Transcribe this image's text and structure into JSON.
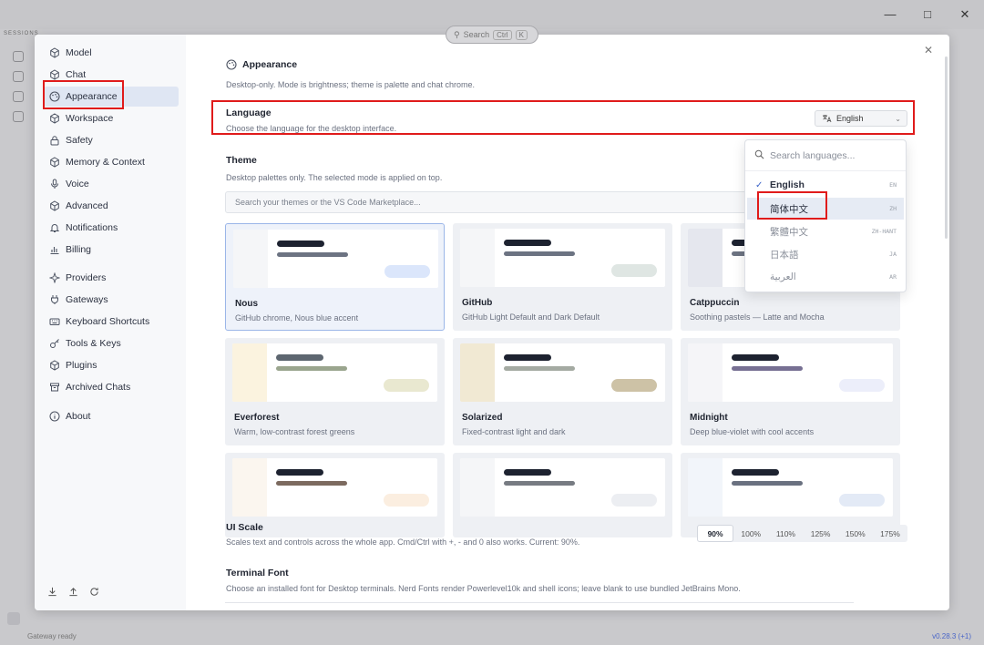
{
  "background": {
    "search_placeholder": "Search",
    "search_kbd1": "Ctrl",
    "search_kbd2": "K",
    "tab_label": "SESSIONS",
    "status_left": "Gateway ready",
    "status_right": "v0.28.3 (+1)"
  },
  "sidebar": {
    "items": [
      {
        "label": "Model",
        "icon": "cube-icon"
      },
      {
        "label": "Chat",
        "icon": "cube-icon"
      },
      {
        "label": "Appearance",
        "icon": "palette-icon"
      },
      {
        "label": "Workspace",
        "icon": "cube-icon"
      },
      {
        "label": "Safety",
        "icon": "lock-icon"
      },
      {
        "label": "Memory & Context",
        "icon": "cube-icon"
      },
      {
        "label": "Voice",
        "icon": "mic-icon"
      },
      {
        "label": "Advanced",
        "icon": "cube-icon"
      },
      {
        "label": "Notifications",
        "icon": "bell-icon"
      },
      {
        "label": "Billing",
        "icon": "chart-icon"
      },
      {
        "label": "Providers",
        "icon": "sparkle-icon"
      },
      {
        "label": "Gateways",
        "icon": "plug-icon"
      },
      {
        "label": "Keyboard Shortcuts",
        "icon": "keyboard-icon"
      },
      {
        "label": "Tools & Keys",
        "icon": "key-icon"
      },
      {
        "label": "Plugins",
        "icon": "cube-icon"
      },
      {
        "label": "Archived Chats",
        "icon": "archive-icon"
      },
      {
        "label": "About",
        "icon": "info-icon"
      }
    ]
  },
  "appearance": {
    "title": "Appearance",
    "desc": "Desktop-only. Mode is brightness; theme is palette and chat chrome."
  },
  "language": {
    "title": "Language",
    "desc": "Choose the language for the desktop interface.",
    "selected": "English"
  },
  "theme": {
    "title": "Theme",
    "desc": "Desktop palettes only. The selected mode is applied on top.",
    "search_placeholder": "Search your themes or the VS Code Marketplace...",
    "cards": [
      {
        "name": "Nous",
        "sub": "GitHub chrome, Nous blue accent",
        "side": "#f5f6f8",
        "bar1": "#1d2230",
        "bar2": "#6c7382",
        "pill": "#dbe6fb"
      },
      {
        "name": "GitHub",
        "sub": "GitHub Light Default and Dark Default",
        "side": "#f5f6f8",
        "bar1": "#1d2230",
        "bar2": "#6c7382",
        "pill": "#dfe6e3"
      },
      {
        "name": "Catppuccin",
        "sub": "Soothing pastels — Latte and Mocha",
        "side": "#e5e7ee",
        "bar1": "#1d2230",
        "bar2": "#6c7382",
        "pill": "#e7e8ef"
      },
      {
        "name": "Everforest",
        "sub": "Warm, low-contrast forest greens",
        "side": "#fbf3df",
        "bar1": "#5d6670",
        "bar2": "#9aa58e",
        "pill": "#e9e8d0"
      },
      {
        "name": "Solarized",
        "sub": "Fixed-contrast light and dark",
        "side": "#f1e9d3",
        "bar1": "#1d2230",
        "bar2": "#a4aaa2",
        "pill": "#cdc2a6"
      },
      {
        "name": "Midnight",
        "sub": "Deep blue-violet with cool accents",
        "side": "#f5f5f8",
        "bar1": "#1d2230",
        "bar2": "#777093",
        "pill": "#eceefa"
      },
      {
        "name": "",
        "sub": "",
        "side": "#fbf6ef",
        "bar1": "#1d2230",
        "bar2": "#7c6a5f",
        "pill": "#fbeee0"
      },
      {
        "name": "",
        "sub": "",
        "side": "#f5f6f8",
        "bar1": "#1d2230",
        "bar2": "#777b82",
        "pill": "#eceef2"
      },
      {
        "name": "",
        "sub": "",
        "side": "#f2f5fa",
        "bar1": "#1d2230",
        "bar2": "#6a7180",
        "pill": "#e3eaf6"
      }
    ]
  },
  "ui_scale": {
    "title": "UI Scale",
    "desc": "Scales text and controls across the whole app. Cmd/Ctrl with +, - and 0 also works. Current: 90%.",
    "options": [
      "90%",
      "100%",
      "110%",
      "125%",
      "150%",
      "175%"
    ],
    "selected_index": 0
  },
  "terminal_font": {
    "title": "Terminal Font",
    "desc": "Choose an installed font for Desktop terminals. Nerd Fonts render Powerlevel10k and shell icons; leave blank to use bundled JetBrains Mono."
  },
  "dropdown": {
    "search_placeholder": "Search languages...",
    "items": [
      {
        "label": "English",
        "code": "EN"
      },
      {
        "label": "简体中文",
        "code": "ZH"
      },
      {
        "label": "繁體中文",
        "code": "ZH-HANT"
      },
      {
        "label": "日本語",
        "code": "JA"
      },
      {
        "label": "العربية",
        "code": "AR"
      }
    ]
  },
  "colors": {
    "accent": "#3c64c8",
    "highlight_red": "#e01b1b",
    "active_nav_bg": "#dfe6f3"
  }
}
